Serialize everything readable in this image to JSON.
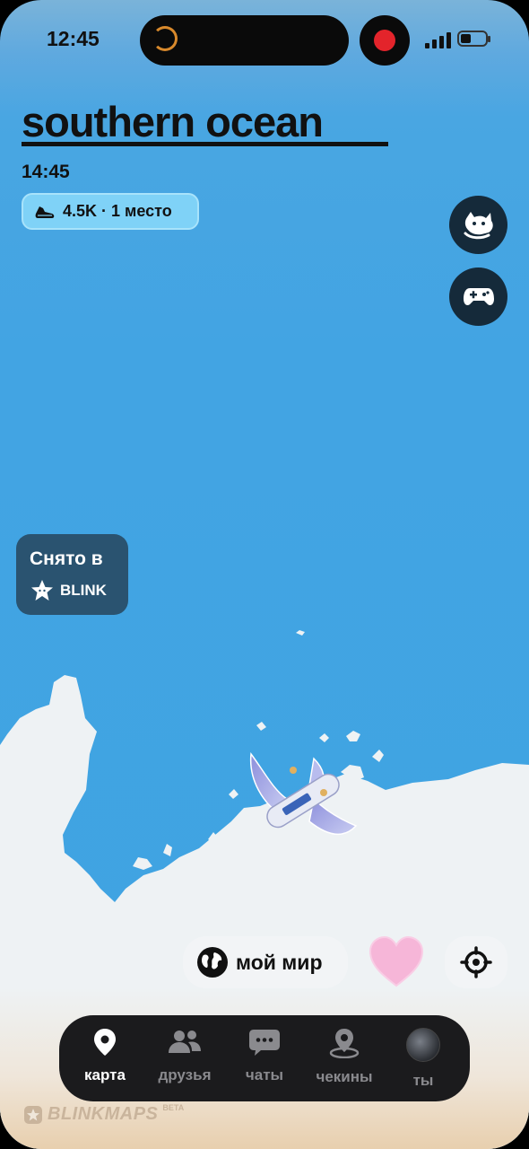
{
  "status_bar": {
    "time": "12:45"
  },
  "header": {
    "title": "southern ocean",
    "time": "14:45",
    "stats": "4.5K · 1 место"
  },
  "badge": {
    "line1": "Снято в",
    "line2": "BLINK"
  },
  "controls": {
    "my_world_label": "мой мир"
  },
  "nav": {
    "items": [
      {
        "label": "карта",
        "icon": "map-pin-icon",
        "active": true
      },
      {
        "label": "друзья",
        "icon": "friends-icon",
        "active": false
      },
      {
        "label": "чаты",
        "icon": "chat-icon",
        "active": false
      },
      {
        "label": "чекины",
        "icon": "checkin-icon",
        "active": false
      },
      {
        "label": "ты",
        "icon": "avatar",
        "active": false
      }
    ]
  },
  "brand": {
    "name": "BLINKMAPS",
    "tag": "BETA"
  },
  "colors": {
    "ocean": "#42a4e3",
    "land": "#eef2f4",
    "nav_bg": "#1b1b1d",
    "pill_bg": "#7fd2f7"
  }
}
